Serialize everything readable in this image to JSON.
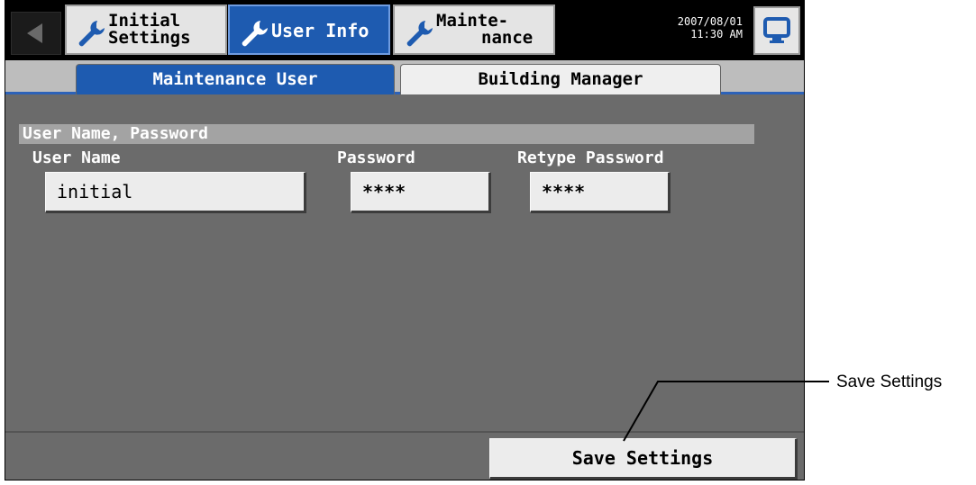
{
  "header": {
    "tabs": [
      {
        "line1": "Initial",
        "line2": "Settings",
        "icon": "wrench-icon",
        "active": false
      },
      {
        "label": "User Info",
        "icon": "wrench-icon",
        "active": true
      },
      {
        "line1": "Mainte-",
        "line2": "nance",
        "icon": "wrench-icon",
        "active": false
      }
    ],
    "date": "2007/08/01",
    "time": "11:30 AM",
    "back_icon": "back-arrow-icon",
    "monitor_icon": "monitor-icon"
  },
  "subtabs": {
    "active": "Maintenance User",
    "inactive": "Building Manager"
  },
  "section": {
    "title": "User Name, Password"
  },
  "fields": {
    "user_name": {
      "label": "User Name",
      "value": "initial"
    },
    "password": {
      "label": "Password",
      "value": "****"
    },
    "retype_password": {
      "label": "Retype Password",
      "value": "****"
    }
  },
  "footer": {
    "save_label": "Save Settings"
  },
  "callout": {
    "label": "Save Settings"
  },
  "colors": {
    "accent_blue": "#1e5bb0",
    "panel_gray": "#6b6b6b",
    "section_gray": "#a3a3a3"
  }
}
